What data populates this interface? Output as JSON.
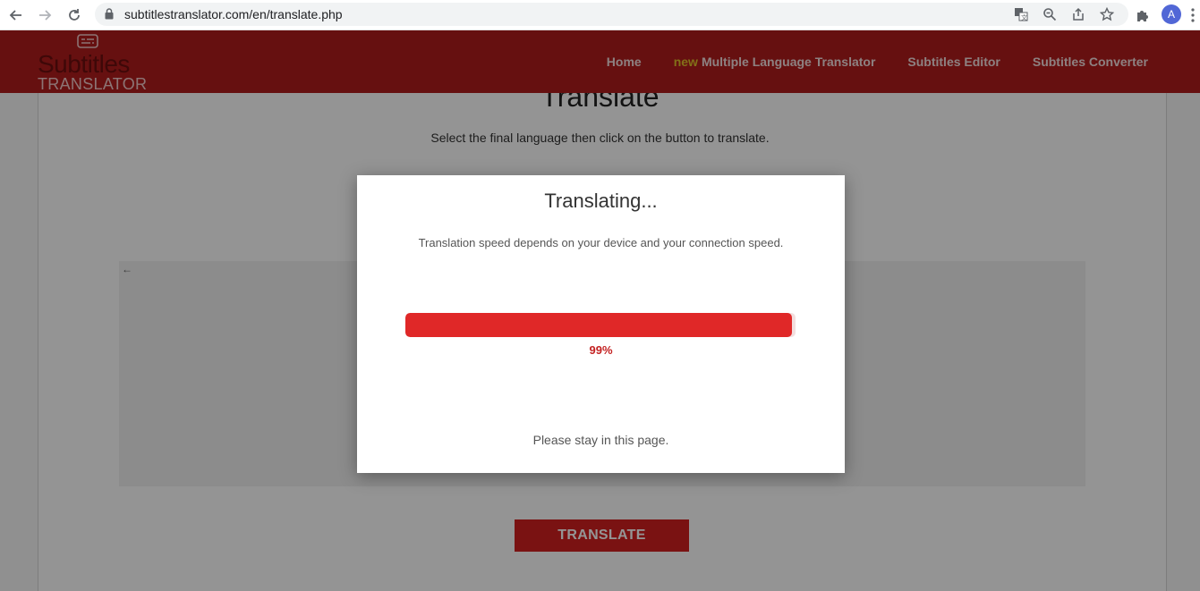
{
  "browser": {
    "url": "subtitlestranslator.com/en/translate.php",
    "avatar_letter": "A"
  },
  "site": {
    "logo_top": "Subtitles",
    "logo_bottom": "TRANSLATOR",
    "nav": {
      "home": "Home",
      "new_badge": "new",
      "multi": "Multiple Language Translator",
      "editor": "Subtitles Editor",
      "converter": "Subtitles Converter"
    }
  },
  "main": {
    "title": "Translate",
    "subtitle": "Select the final language then click on the button to translate.",
    "back_arrow": "←",
    "translate_button": "TRANSLATE"
  },
  "modal": {
    "title": "Translating...",
    "description": "Translation speed depends on your device and your connection speed.",
    "progress_percent": 99,
    "progress_label": "99%",
    "footer": "Please stay in this page."
  },
  "colors": {
    "header_red": "#b01c1c",
    "progress_red": "#e02828",
    "button_red": "#d32020"
  }
}
